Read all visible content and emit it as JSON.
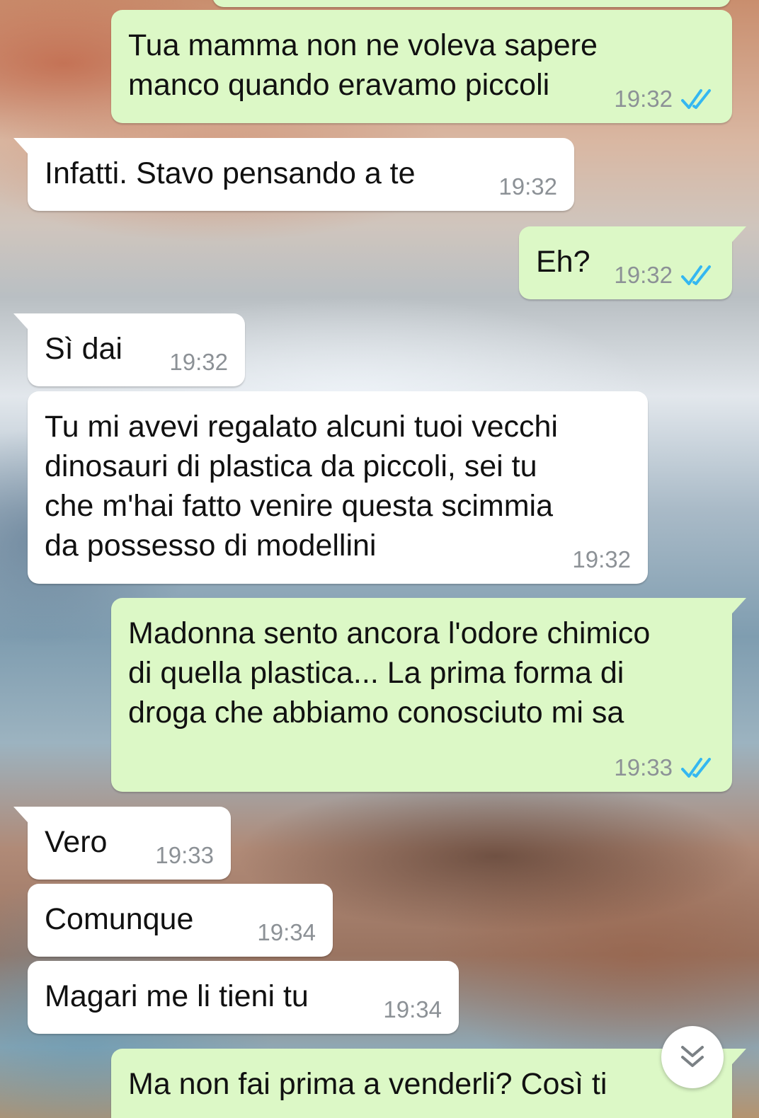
{
  "chat": {
    "messages": [
      {
        "id": "m1",
        "direction": "out",
        "text": "Tua mamma non ne voleva sapere\nmanco quando eravamo piccoli",
        "time": "19:32",
        "status": "read"
      },
      {
        "id": "m2",
        "direction": "in",
        "text": "Infatti. Stavo pensando a te",
        "time": "19:32"
      },
      {
        "id": "m3",
        "direction": "out",
        "text": "Eh?",
        "time": "19:32",
        "status": "read"
      },
      {
        "id": "m4",
        "direction": "in",
        "text": "Sì dai",
        "time": "19:32"
      },
      {
        "id": "m5",
        "direction": "in",
        "text": "Tu mi avevi regalato alcuni tuoi vecchi\ndinosauri di plastica da piccoli, sei tu\nche m'hai fatto venire questa scimmia\nda possesso di modellini",
        "time": "19:32"
      },
      {
        "id": "m6",
        "direction": "out",
        "text": "Madonna sento ancora l'odore chimico\ndi quella plastica... La prima forma di\ndroga che abbiamo conosciuto mi sa",
        "time": "19:33",
        "status": "read"
      },
      {
        "id": "m7",
        "direction": "in",
        "text": "Vero",
        "time": "19:33"
      },
      {
        "id": "m8",
        "direction": "in",
        "text": "Comunque",
        "time": "19:34"
      },
      {
        "id": "m9",
        "direction": "in",
        "text": "Magari me li tieni tu",
        "time": "19:34"
      },
      {
        "id": "m10",
        "direction": "out",
        "text": "Ma non fai prima a venderli? Così ti",
        "time": ""
      }
    ],
    "scroll_down_icon": "double-chevron-down-icon",
    "read_receipt_icon": "double-check-icon"
  },
  "colors": {
    "outgoing_bubble": "#dcf8c6",
    "incoming_bubble": "#ffffff",
    "read_ticks": "#34b7f1",
    "timestamp": "#8c9196"
  }
}
